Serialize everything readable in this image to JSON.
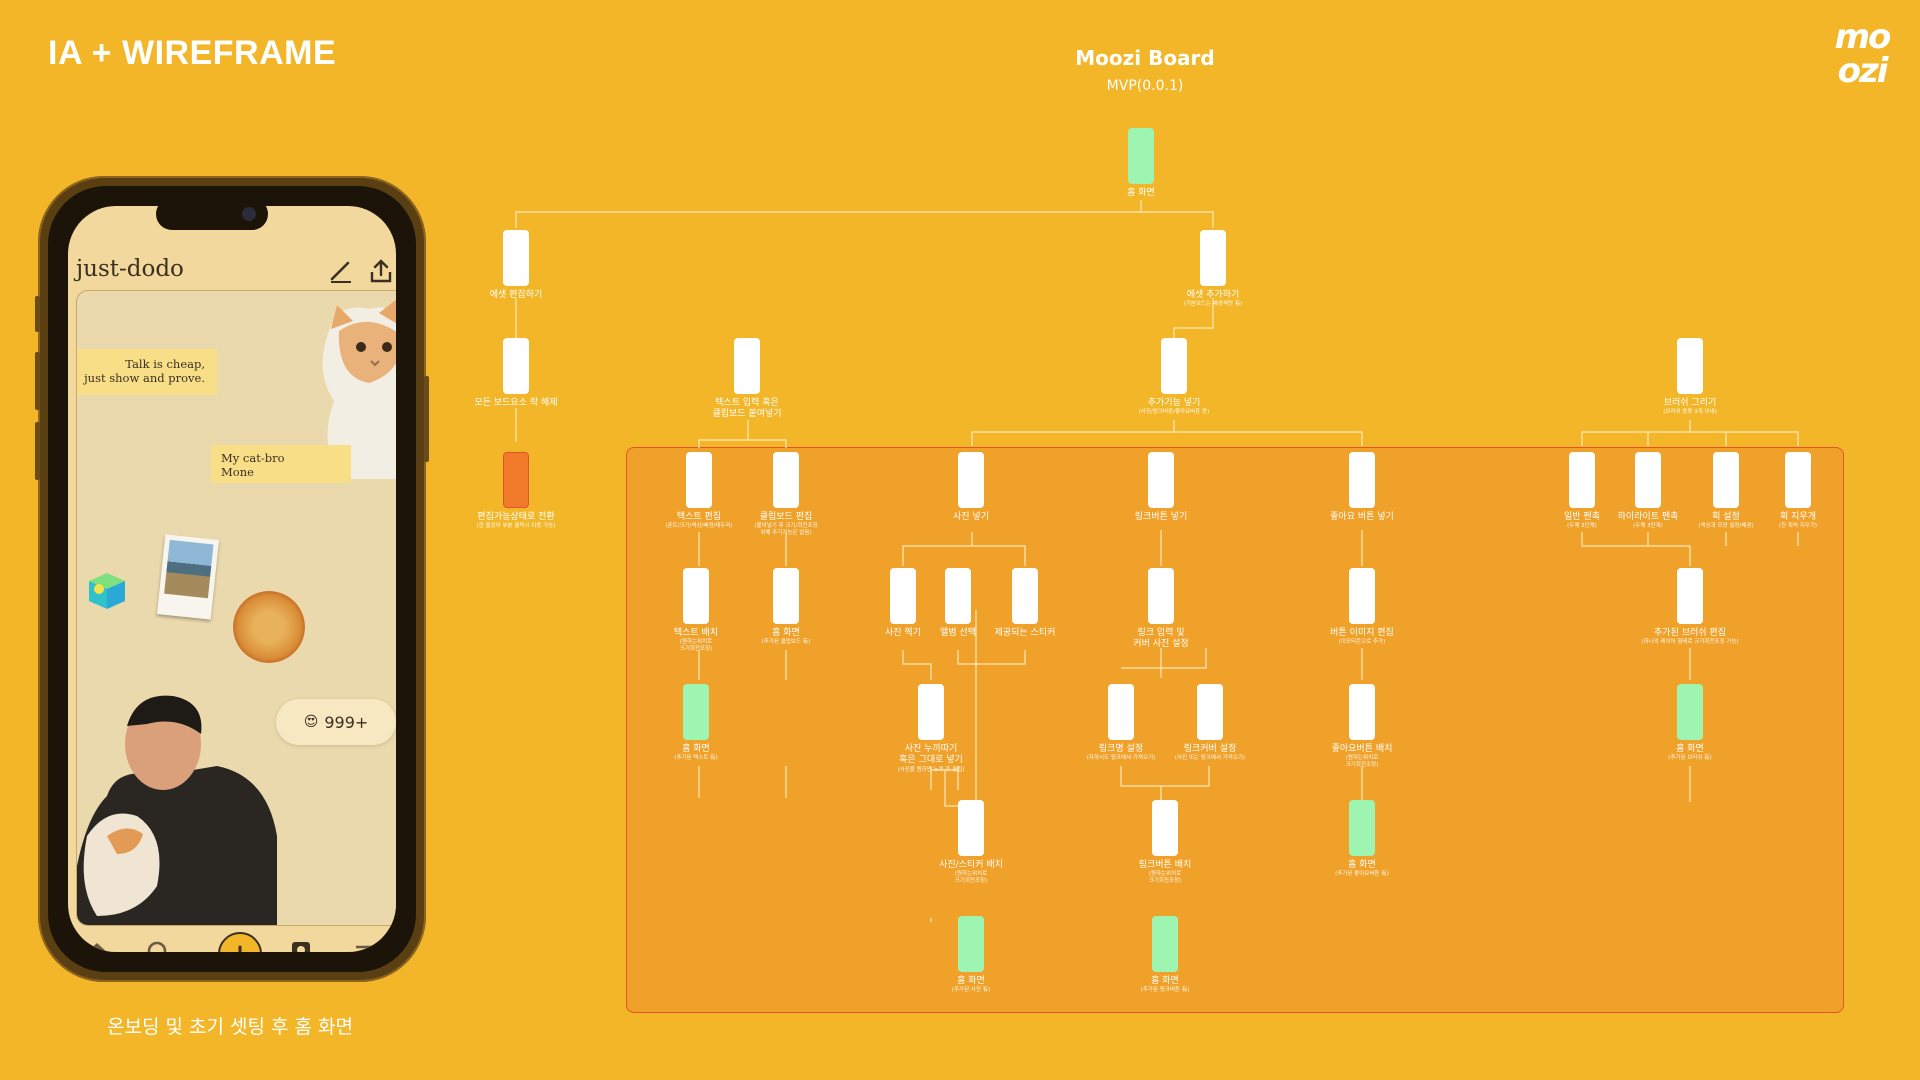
{
  "header": {
    "title": "IA + WIREFRAME",
    "logo_text": "moozi",
    "board_title": "Moozi Board",
    "board_version": "MVP(0.0.1)"
  },
  "colors": {
    "background": "#F2B628",
    "mvp_area": "#EFA12A",
    "mvp_border": "#E8542A",
    "home_screen_box": "#9EF5B2",
    "edit_mode_box": "#F07A2A",
    "screen_box": "#FFFFFF"
  },
  "phone": {
    "caption": "온보딩 및 초기 셋팅 후 홈 화면",
    "app_name": "just-dodo",
    "note_1": "Talk is cheap,\njust show and prove.",
    "note_2": "My cat-bro\nMone",
    "like_count": "999+",
    "like_emoji": "😍",
    "icons": [
      "edit-icon",
      "share-icon",
      "home-icon",
      "search-icon",
      "add-icon",
      "profile-icon",
      "menu-icon"
    ]
  },
  "nodes": {
    "root": {
      "label": "홈 화면"
    },
    "widget_edit": {
      "label": "에셋 편집하기"
    },
    "widget_add": {
      "label": "에셋 추가하기",
      "sub": "(기본보드는 배경색만 有)"
    },
    "all_board_fix": {
      "label": "모든 보드요소 락 해제"
    },
    "edit_mode": {
      "label": "편집가능상태로 전환",
      "sub": "(한 들었어 부분 클릭시 이동 가능)"
    },
    "text_input": {
      "label": "텍스트 입력 혹은\n클립보드 붙여넣기"
    },
    "feature_add": {
      "label": "추가기능 넣기",
      "sub": "(사진/링크버튼/좋아요버튼 등)"
    },
    "brush": {
      "label": "브러쉬 그리기",
      "sub": "(브러쉬 종류 3개 이내)"
    },
    "text_edit": {
      "label": "텍스트 편집",
      "sub": "(폰트/크기/색상/배경/테두리)"
    },
    "clip_edit": {
      "label": "클립보드 편집",
      "sub": "(붙여넣기 후 크기/회전조정\n위해 추가기능은 없음)"
    },
    "text_place": {
      "label": "텍스트 배치",
      "sub": "(원하는위치로\n크기회전조정)"
    },
    "clip_home": {
      "label": "홈 화면",
      "sub": "(추가된 클립보드 有)"
    },
    "text_home": {
      "label": "홈 화면",
      "sub": "(추가된 텍스트 有)"
    },
    "photo_add": {
      "label": "사진 넣기"
    },
    "photo_take": {
      "label": "사진 찍기"
    },
    "album_select": {
      "label": "앨범 선택"
    },
    "sticker": {
      "label": "제공되는 스티커"
    },
    "photo_crop": {
      "label": "사진 누끼따기\n혹은 그대로 넣기",
      "sub": "(사진을 원하면 누끼 후 편집)"
    },
    "photo_place": {
      "label": "사진/스티커 배치",
      "sub": "(원하는위치로\n크기회전조정)"
    },
    "photo_home": {
      "label": "홈 화면",
      "sub": "(추가된 사진 有)"
    },
    "link_add": {
      "label": "링크버튼 넣기"
    },
    "link_input": {
      "label": "링크 입력 및\n커버 사진 설정"
    },
    "link_name": {
      "label": "링크명 설정",
      "sub": "(자하시도 링크에서 가져오기)"
    },
    "link_cover": {
      "label": "링크커버 설정",
      "sub": "(사진 또는 링크에서 가져오기)"
    },
    "link_place": {
      "label": "링크버튼 배치",
      "sub": "(원하는위치로\n크기회전조정)"
    },
    "link_home": {
      "label": "홈 화면",
      "sub": "(추가된 링크버튼 有)"
    },
    "like_add": {
      "label": "좋아요 버튼 넣기"
    },
    "like_img": {
      "label": "버튼 이미지 편집",
      "sub": "(이모티콘으로 추가)"
    },
    "like_place": {
      "label": "좋아요버튼 배치",
      "sub": "(원하는위치로\n크기회전조정)"
    },
    "like_home": {
      "label": "홈 화면",
      "sub": "(추가된 좋아요버튼 有)"
    },
    "brush_pen": {
      "label": "일반 펜촉",
      "sub": "(두께 3단계)"
    },
    "brush_hl": {
      "label": "하이라이트 펜촉",
      "sub": "(두께 3단계)"
    },
    "brush_color": {
      "label": "획 설정",
      "sub": "(색상과 모양 설정/배경)"
    },
    "brush_erase": {
      "label": "획 지우개",
      "sub": "(한 획씩 지우기)"
    },
    "brush_edit": {
      "label": "추가된 브러쉬 편집",
      "sub": "(하나의 레이어 형태로 크기회전조정 가능)"
    },
    "brush_home": {
      "label": "홈 화면",
      "sub": "(추가된 브러쉬 有)"
    }
  }
}
